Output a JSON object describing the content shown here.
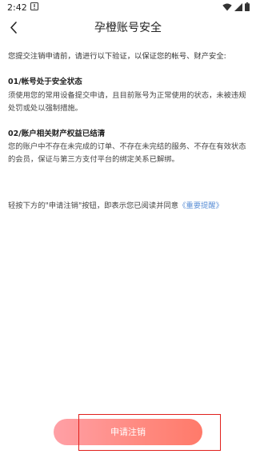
{
  "status_bar": {
    "time": "2:42",
    "icons": [
      "alert-icon",
      "wifi-icon",
      "signal-icon",
      "battery-icon"
    ]
  },
  "nav": {
    "back_icon": "chevron-left-icon",
    "title": "孕橙账号安全"
  },
  "intro": "您提交注销申请前，请进行以下验证，以保证您的帐号、财产安全:",
  "sections": [
    {
      "title": "01/帐号处于安全状态",
      "body": "须使用您的常用设备提交申请，且目前账号为正常使用的状态，未被违规处罚或处以强制措施。"
    },
    {
      "title": "02/账户相关财产权益已结清",
      "body": "您的账户中不存在未完成的订单、不存在未完结的服务、不存在有效状态的会员，保证与第三方支付平台的绑定关系已解绑。"
    }
  ],
  "notice": {
    "text": "轻按下方的\"申请注销\"按钮，即表示您已阅读并同意",
    "link": "《重要提醒》"
  },
  "apply_button": {
    "label": "申请注销"
  },
  "colors": {
    "link": "#5b8fd6",
    "button_gradient_start": "#ffa0a6",
    "button_gradient_end": "#ff7a6a",
    "highlight_box": "#e0201c"
  }
}
